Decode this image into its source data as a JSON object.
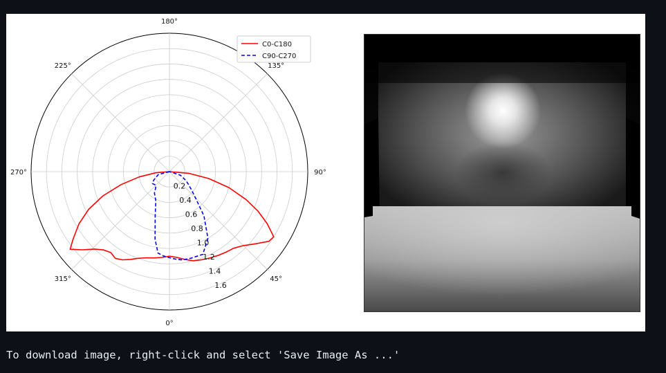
{
  "caption": "To download image, right-click and select 'Save Image As ...'",
  "chart_data": [
    {
      "type": "polar-line",
      "angle_unit": "deg",
      "angle_tick_labels": [
        "180°",
        "135°",
        "90°",
        "45°",
        "0°",
        "315°",
        "270°",
        "225°"
      ],
      "radial_tick_labels": [
        "0.2",
        "0.4",
        "0.6",
        "0.8",
        "1.0",
        "1.2",
        "1.4",
        "1.6"
      ],
      "rlim": [
        0,
        1.8
      ],
      "grid": true,
      "legend_position": "top-right",
      "colors": {
        "C0-C180": "#ff0000",
        "C90-C270": "#0000ee"
      },
      "series": [
        {
          "name": "C0-C180",
          "line_style": "solid",
          "points": [
            [
              -90,
              0.0
            ],
            [
              -85,
              0.18
            ],
            [
              -80,
              0.4
            ],
            [
              -75,
              0.65
            ],
            [
              -70,
              0.92
            ],
            [
              -65,
              1.16
            ],
            [
              -60,
              1.36
            ],
            [
              -55,
              1.53
            ],
            [
              -52,
              1.64
            ],
            [
              -48,
              1.52
            ],
            [
              -44,
              1.4
            ],
            [
              -40,
              1.33
            ],
            [
              -36,
              1.3
            ],
            [
              -32,
              1.33
            ],
            [
              -28,
              1.3
            ],
            [
              -24,
              1.25
            ],
            [
              -20,
              1.2
            ],
            [
              -15,
              1.16
            ],
            [
              -10,
              1.14
            ],
            [
              -5,
              1.12
            ],
            [
              0,
              1.1
            ],
            [
              5,
              1.12
            ],
            [
              10,
              1.16
            ],
            [
              15,
              1.2
            ],
            [
              20,
              1.22
            ],
            [
              25,
              1.24
            ],
            [
              30,
              1.26
            ],
            [
              35,
              1.28
            ],
            [
              40,
              1.3
            ],
            [
              45,
              1.36
            ],
            [
              50,
              1.46
            ],
            [
              55,
              1.58
            ],
            [
              58,
              1.6
            ],
            [
              62,
              1.44
            ],
            [
              66,
              1.26
            ],
            [
              70,
              1.06
            ],
            [
              75,
              0.8
            ],
            [
              80,
              0.52
            ],
            [
              85,
              0.25
            ],
            [
              90,
              0.0
            ]
          ]
        },
        {
          "name": "C90-C270",
          "line_style": "dashed",
          "points": [
            [
              -90,
              0.0
            ],
            [
              -75,
              0.15
            ],
            [
              -62,
              0.23
            ],
            [
              -55,
              0.27
            ],
            [
              -45,
              0.25
            ],
            [
              -40,
              0.28
            ],
            [
              -35,
              0.34
            ],
            [
              -25,
              0.42
            ],
            [
              -18,
              0.6
            ],
            [
              -12,
              0.9
            ],
            [
              -8,
              1.07
            ],
            [
              -4,
              1.1
            ],
            [
              0,
              1.12
            ],
            [
              4,
              1.14
            ],
            [
              8,
              1.16
            ],
            [
              14,
              1.16
            ],
            [
              22,
              1.16
            ],
            [
              30,
              1.0
            ],
            [
              38,
              0.73
            ],
            [
              44,
              0.5
            ],
            [
              50,
              0.38
            ],
            [
              56,
              0.3
            ],
            [
              62,
              0.24
            ],
            [
              72,
              0.15
            ],
            [
              90,
              0.0
            ]
          ]
        }
      ]
    },
    {
      "type": "image",
      "colormap": "grayscale"
    }
  ]
}
